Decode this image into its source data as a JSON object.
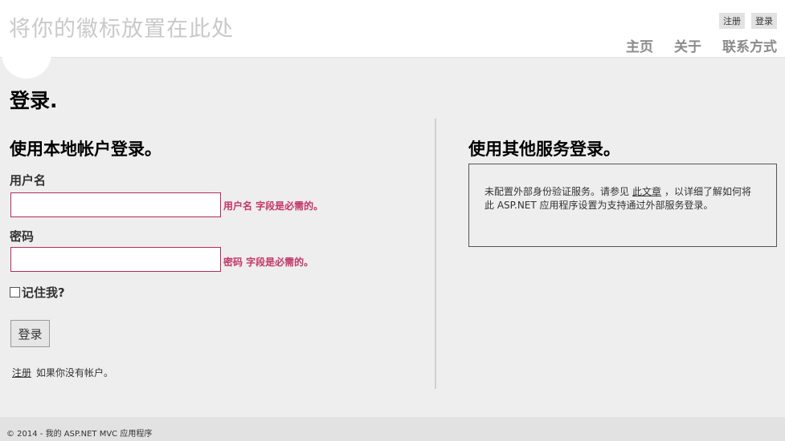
{
  "header": {
    "logo_text": "将你的徽标放置在此处",
    "register_link": "注册",
    "login_link": "登录",
    "nav": [
      {
        "label": "主页"
      },
      {
        "label": "关于"
      },
      {
        "label": "联系方式"
      }
    ]
  },
  "main": {
    "page_title": "登录.",
    "local": {
      "title": "使用本地帐户登录。",
      "username_label": "用户名",
      "username_value": "",
      "username_error": "用户名 字段是必需的。",
      "password_label": "密码",
      "password_value": "",
      "password_error": "密码 字段是必需的。",
      "remember_label": "记住我?",
      "remember_checked": false,
      "submit_label": "登录",
      "register_link": "注册",
      "register_suffix": "如果你没有帐户。"
    },
    "external": {
      "title": "使用其他服务登录。",
      "text_before": "未配置外部身份验证服务。请参见",
      "link_text": "此文章",
      "text_after": "，以详细了解如何将此 ASP.NET 应用程序设置为支持通过外部服务登录。"
    }
  },
  "footer": {
    "text": "© 2014 - 我的 ASP.NET MVC 应用程序"
  },
  "colors": {
    "validation": "#c43566",
    "input_border": "#b32b5a",
    "nav_text": "#8b8b8b",
    "background": "#efeeef"
  }
}
